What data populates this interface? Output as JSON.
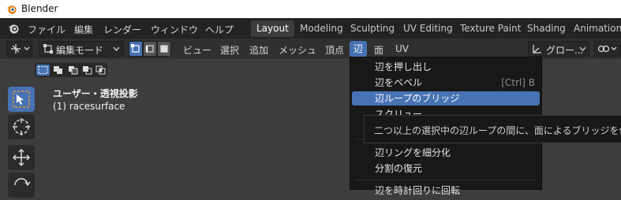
{
  "window": {
    "title": "Blender"
  },
  "topbar": {
    "menus": [
      "ファイル",
      "編集",
      "レンダー",
      "ウィンドウ",
      "ヘルプ"
    ],
    "workspaces": [
      {
        "label": "Layout",
        "active": true
      },
      {
        "label": "Modeling"
      },
      {
        "label": "Sculpting"
      },
      {
        "label": "UV Editing"
      },
      {
        "label": "Texture Paint"
      },
      {
        "label": "Shading"
      },
      {
        "label": "Animation"
      }
    ]
  },
  "viewport_header": {
    "mode": "編集モード",
    "menus": [
      "ビュー",
      "選択",
      "追加",
      "メッシュ",
      "頂点",
      "辺",
      "面",
      "UV"
    ],
    "active_menu": "辺",
    "orientation": "グロー..."
  },
  "viewport": {
    "overlay_line1": "ユーザー・透視投影",
    "overlay_line2": "(1) racesurface"
  },
  "edge_menu": {
    "items": [
      {
        "label": "辺を押し出し",
        "shortcut": ""
      },
      {
        "label": "辺をベベル",
        "shortcut": "[Ctrl] B"
      },
      {
        "label": "辺ループのブリッジ",
        "shortcut": "",
        "highlighted": true
      },
      {
        "label": "スクリュー",
        "shortcut": ""
      },
      {
        "label": "辺リングを細分化",
        "shortcut": ""
      },
      {
        "label": "分割の復元",
        "shortcut": ""
      },
      {
        "label": "辺を時計回りに回転",
        "shortcut": ""
      }
    ]
  },
  "tooltip": {
    "text": "二つ以上の選択中の辺ループの間に、面によるブリッジを作成し"
  },
  "colors": {
    "accent": "#4772b3",
    "menu_bg": "#181818",
    "header_bg": "#303030",
    "topbar_bg": "#232323"
  }
}
